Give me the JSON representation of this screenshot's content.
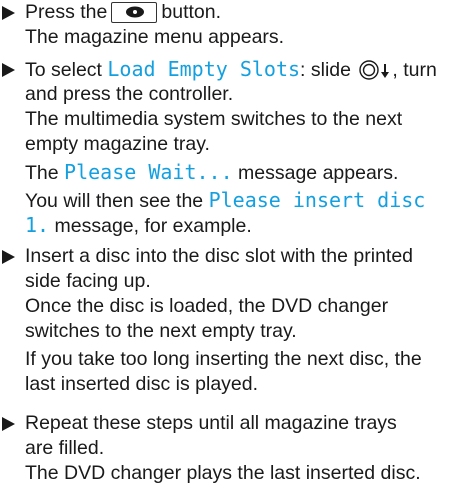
{
  "steps": [
    {
      "press": {
        "prefix": "Press the",
        "suffix": "button."
      },
      "line2": "The magazine menu appears."
    },
    {
      "l1_prefix": "To select ",
      "l1_hl": "Load Empty Slots",
      "l1_suffix": ": slide ",
      "l1_after_icon": ", turn",
      "l2": "and press the controller.",
      "l3": "The multimedia system switches to the next",
      "l4": "empty magazine tray.",
      "l5_prefix": "The ",
      "l5_hl": "Please Wait...",
      "l5_suffix": " message appears.",
      "l6_prefix": "You will then see the ",
      "l6_hl": "Please insert disc",
      "l7_hl": "1.",
      "l7_suffix": " message, for example."
    },
    {
      "l1": "Insert a disc into the disc slot with the printed",
      "l2": "side facing up.",
      "l3": "Once the disc is loaded, the DVD changer",
      "l4": "switches to the next empty tray.",
      "l5": "If you take too long inserting the next disc, the",
      "l6": "last inserted disc is played."
    },
    {
      "l1": "Repeat these steps until all magazine trays",
      "l2": "are filled.",
      "l3": "The DVD changer plays the last inserted disc."
    }
  ],
  "colors": {
    "text": "#1a1a1a",
    "highlight": "#14a0e0"
  },
  "icons": {
    "bullet": "triangle-arrow-icon",
    "media_button": "disc-button-icon",
    "controller": "controller-slide-down-icon"
  }
}
